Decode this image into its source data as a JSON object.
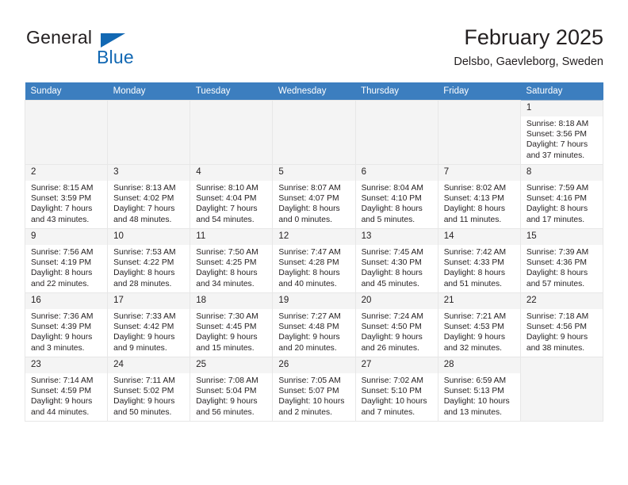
{
  "brand": {
    "name_top": "General",
    "name_bottom": "Blue",
    "accent_color": "#1268b3"
  },
  "header": {
    "title": "February 2025",
    "subtitle": "Delsbo, Gaevleborg, Sweden"
  },
  "calendar": {
    "header_bg": "#3c7ebf",
    "weekdays": [
      "Sunday",
      "Monday",
      "Tuesday",
      "Wednesday",
      "Thursday",
      "Friday",
      "Saturday"
    ],
    "weeks": [
      [
        {
          "day": "",
          "empty": true
        },
        {
          "day": "",
          "empty": true
        },
        {
          "day": "",
          "empty": true
        },
        {
          "day": "",
          "empty": true
        },
        {
          "day": "",
          "empty": true
        },
        {
          "day": "",
          "empty": true
        },
        {
          "day": "1",
          "sunrise": "Sunrise: 8:18 AM",
          "sunset": "Sunset: 3:56 PM",
          "daylight1": "Daylight: 7 hours",
          "daylight2": "and 37 minutes."
        }
      ],
      [
        {
          "day": "2",
          "sunrise": "Sunrise: 8:15 AM",
          "sunset": "Sunset: 3:59 PM",
          "daylight1": "Daylight: 7 hours",
          "daylight2": "and 43 minutes."
        },
        {
          "day": "3",
          "sunrise": "Sunrise: 8:13 AM",
          "sunset": "Sunset: 4:02 PM",
          "daylight1": "Daylight: 7 hours",
          "daylight2": "and 48 minutes."
        },
        {
          "day": "4",
          "sunrise": "Sunrise: 8:10 AM",
          "sunset": "Sunset: 4:04 PM",
          "daylight1": "Daylight: 7 hours",
          "daylight2": "and 54 minutes."
        },
        {
          "day": "5",
          "sunrise": "Sunrise: 8:07 AM",
          "sunset": "Sunset: 4:07 PM",
          "daylight1": "Daylight: 8 hours",
          "daylight2": "and 0 minutes."
        },
        {
          "day": "6",
          "sunrise": "Sunrise: 8:04 AM",
          "sunset": "Sunset: 4:10 PM",
          "daylight1": "Daylight: 8 hours",
          "daylight2": "and 5 minutes."
        },
        {
          "day": "7",
          "sunrise": "Sunrise: 8:02 AM",
          "sunset": "Sunset: 4:13 PM",
          "daylight1": "Daylight: 8 hours",
          "daylight2": "and 11 minutes."
        },
        {
          "day": "8",
          "sunrise": "Sunrise: 7:59 AM",
          "sunset": "Sunset: 4:16 PM",
          "daylight1": "Daylight: 8 hours",
          "daylight2": "and 17 minutes."
        }
      ],
      [
        {
          "day": "9",
          "sunrise": "Sunrise: 7:56 AM",
          "sunset": "Sunset: 4:19 PM",
          "daylight1": "Daylight: 8 hours",
          "daylight2": "and 22 minutes."
        },
        {
          "day": "10",
          "sunrise": "Sunrise: 7:53 AM",
          "sunset": "Sunset: 4:22 PM",
          "daylight1": "Daylight: 8 hours",
          "daylight2": "and 28 minutes."
        },
        {
          "day": "11",
          "sunrise": "Sunrise: 7:50 AM",
          "sunset": "Sunset: 4:25 PM",
          "daylight1": "Daylight: 8 hours",
          "daylight2": "and 34 minutes."
        },
        {
          "day": "12",
          "sunrise": "Sunrise: 7:47 AM",
          "sunset": "Sunset: 4:28 PM",
          "daylight1": "Daylight: 8 hours",
          "daylight2": "and 40 minutes."
        },
        {
          "day": "13",
          "sunrise": "Sunrise: 7:45 AM",
          "sunset": "Sunset: 4:30 PM",
          "daylight1": "Daylight: 8 hours",
          "daylight2": "and 45 minutes."
        },
        {
          "day": "14",
          "sunrise": "Sunrise: 7:42 AM",
          "sunset": "Sunset: 4:33 PM",
          "daylight1": "Daylight: 8 hours",
          "daylight2": "and 51 minutes."
        },
        {
          "day": "15",
          "sunrise": "Sunrise: 7:39 AM",
          "sunset": "Sunset: 4:36 PM",
          "daylight1": "Daylight: 8 hours",
          "daylight2": "and 57 minutes."
        }
      ],
      [
        {
          "day": "16",
          "sunrise": "Sunrise: 7:36 AM",
          "sunset": "Sunset: 4:39 PM",
          "daylight1": "Daylight: 9 hours",
          "daylight2": "and 3 minutes."
        },
        {
          "day": "17",
          "sunrise": "Sunrise: 7:33 AM",
          "sunset": "Sunset: 4:42 PM",
          "daylight1": "Daylight: 9 hours",
          "daylight2": "and 9 minutes."
        },
        {
          "day": "18",
          "sunrise": "Sunrise: 7:30 AM",
          "sunset": "Sunset: 4:45 PM",
          "daylight1": "Daylight: 9 hours",
          "daylight2": "and 15 minutes."
        },
        {
          "day": "19",
          "sunrise": "Sunrise: 7:27 AM",
          "sunset": "Sunset: 4:48 PM",
          "daylight1": "Daylight: 9 hours",
          "daylight2": "and 20 minutes."
        },
        {
          "day": "20",
          "sunrise": "Sunrise: 7:24 AM",
          "sunset": "Sunset: 4:50 PM",
          "daylight1": "Daylight: 9 hours",
          "daylight2": "and 26 minutes."
        },
        {
          "day": "21",
          "sunrise": "Sunrise: 7:21 AM",
          "sunset": "Sunset: 4:53 PM",
          "daylight1": "Daylight: 9 hours",
          "daylight2": "and 32 minutes."
        },
        {
          "day": "22",
          "sunrise": "Sunrise: 7:18 AM",
          "sunset": "Sunset: 4:56 PM",
          "daylight1": "Daylight: 9 hours",
          "daylight2": "and 38 minutes."
        }
      ],
      [
        {
          "day": "23",
          "sunrise": "Sunrise: 7:14 AM",
          "sunset": "Sunset: 4:59 PM",
          "daylight1": "Daylight: 9 hours",
          "daylight2": "and 44 minutes."
        },
        {
          "day": "24",
          "sunrise": "Sunrise: 7:11 AM",
          "sunset": "Sunset: 5:02 PM",
          "daylight1": "Daylight: 9 hours",
          "daylight2": "and 50 minutes."
        },
        {
          "day": "25",
          "sunrise": "Sunrise: 7:08 AM",
          "sunset": "Sunset: 5:04 PM",
          "daylight1": "Daylight: 9 hours",
          "daylight2": "and 56 minutes."
        },
        {
          "day": "26",
          "sunrise": "Sunrise: 7:05 AM",
          "sunset": "Sunset: 5:07 PM",
          "daylight1": "Daylight: 10 hours",
          "daylight2": "and 2 minutes."
        },
        {
          "day": "27",
          "sunrise": "Sunrise: 7:02 AM",
          "sunset": "Sunset: 5:10 PM",
          "daylight1": "Daylight: 10 hours",
          "daylight2": "and 7 minutes."
        },
        {
          "day": "28",
          "sunrise": "Sunrise: 6:59 AM",
          "sunset": "Sunset: 5:13 PM",
          "daylight1": "Daylight: 10 hours",
          "daylight2": "and 13 minutes."
        },
        {
          "day": "",
          "empty": true
        }
      ]
    ]
  }
}
